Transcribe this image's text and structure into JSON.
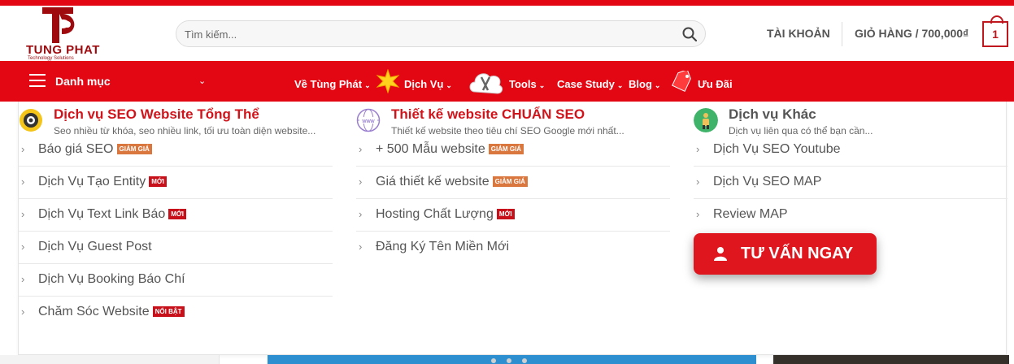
{
  "header": {
    "logo_text": "TUNG PHAT",
    "logo_subtext": "Technology Solutions",
    "search_placeholder": "Tìm kiếm...",
    "account_label": "TÀI KHOẢN",
    "cart_label": "GIỎ HÀNG / 700,000₫",
    "cart_count": "1"
  },
  "nav": {
    "categories_label": "Danh mục",
    "items": [
      {
        "label": "Về Tùng Phát"
      },
      {
        "label": "Dịch Vụ"
      },
      {
        "label": "Tools"
      },
      {
        "label": "Case Study"
      },
      {
        "label": "Blog"
      },
      {
        "label": "Ưu Đãi"
      }
    ]
  },
  "mega_menu": {
    "columns": [
      {
        "title": "Dịch vụ SEO Website Tổng Thể",
        "subtitle": "Seo nhiều từ khóa, seo nhiều link, tối ưu toàn diện website...",
        "items": [
          {
            "label": "Báo giá SEO",
            "badge": "GIẢM GIÁ"
          },
          {
            "label": "Dịch Vụ Tạo Entity",
            "badge": "MỚI"
          },
          {
            "label": "Dịch Vụ Text Link Báo",
            "badge": "MỚI"
          },
          {
            "label": "Dịch Vụ Guest Post",
            "badge": ""
          },
          {
            "label": "Dịch Vụ Booking Báo Chí",
            "badge": ""
          },
          {
            "label": "Chăm Sóc Website",
            "badge": "NỔI BẬT"
          }
        ]
      },
      {
        "title": "Thiết kế website CHUẨN SEO",
        "subtitle": "Thiết kế website theo tiêu chí SEO Google mới nhất...",
        "items": [
          {
            "label": "+ 500 Mẫu website",
            "badge": "GIẢM GIÁ"
          },
          {
            "label": "Giá thiết kế website",
            "badge": "GIẢM GIÁ"
          },
          {
            "label": "Hosting Chất Lượng",
            "badge": "MỚI"
          },
          {
            "label": "Đăng Ký Tên Miền Mới",
            "badge": ""
          }
        ]
      },
      {
        "title": "Dịch vụ Khác",
        "subtitle": "Dịch vụ liên qua có thể bạn cần...",
        "items": [
          {
            "label": "Dịch Vụ SEO Youtube",
            "badge": ""
          },
          {
            "label": "Dịch Vụ SEO MAP",
            "badge": ""
          },
          {
            "label": "Review MAP",
            "badge": ""
          }
        ]
      }
    ],
    "cta_label": "TƯ VẤN NGAY"
  },
  "colors": {
    "brand_red": "#e30613",
    "dark_red": "#9e0a0e",
    "badge_sale": "#d9773f",
    "badge_new": "#c8101a"
  },
  "icons": {
    "search": "search-icon",
    "menu": "hamburger-icon",
    "star": "star-burst-icon",
    "cloud_tools": "cloud-tools-icon",
    "sale_tag": "sale-tag-icon",
    "target": "target-icon",
    "www": "www-globe-icon",
    "person": "person-icon",
    "user": "user-icon"
  }
}
